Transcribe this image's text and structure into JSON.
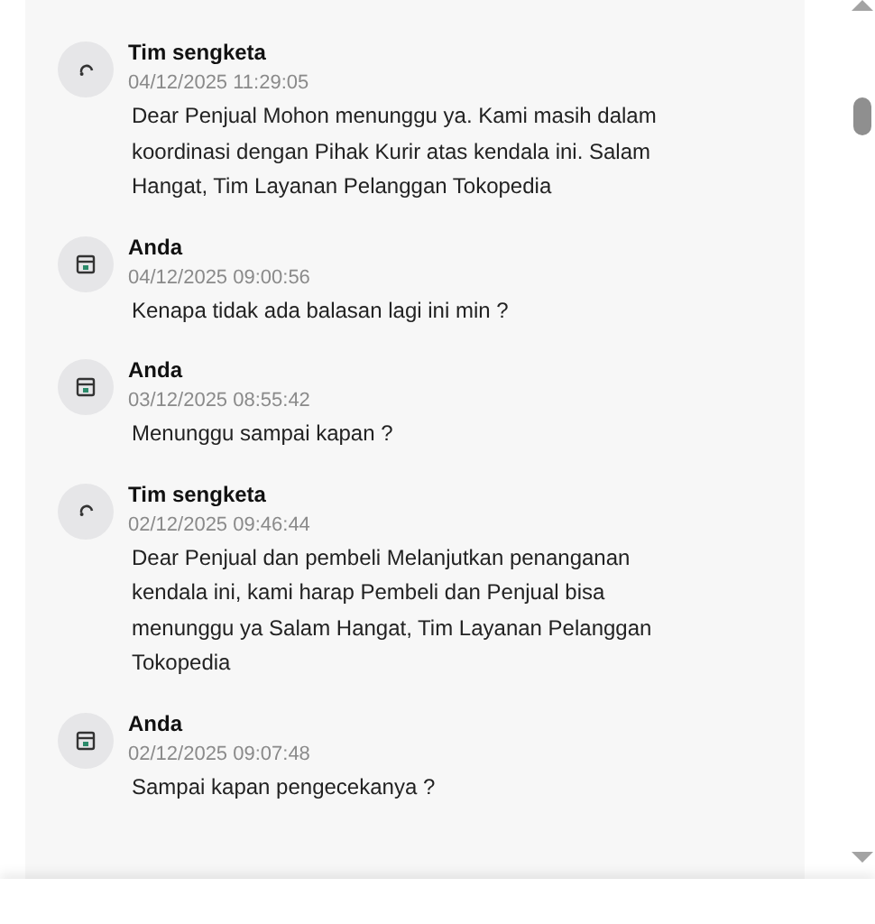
{
  "messages": [
    {
      "kind": "agent",
      "sender": "Tim sengketa",
      "time": "04/12/2025 11:29:05",
      "text": "Dear Penjual Mohon menunggu ya. Kami masih dalam koordinasi dengan Pihak Kurir atas kendala ini. Salam Hangat, Tim Layanan Pelanggan Tokopedia"
    },
    {
      "kind": "user",
      "sender": "Anda",
      "time": "04/12/2025 09:00:56",
      "text": "Kenapa tidak ada balasan lagi ini min ?"
    },
    {
      "kind": "user",
      "sender": "Anda",
      "time": "03/12/2025 08:55:42",
      "text": "Menunggu sampai kapan ?"
    },
    {
      "kind": "agent",
      "sender": "Tim sengketa",
      "time": "02/12/2025 09:46:44",
      "text": "Dear Penjual dan pembeli Melanjutkan penanganan kendala ini, kami harap Pembeli dan Penjual bisa menunggu ya Salam Hangat, Tim Layanan Pelanggan Tokopedia"
    },
    {
      "kind": "user",
      "sender": "Anda",
      "time": "02/12/2025 09:07:48",
      "text": "Sampai kapan pengecekanya ?"
    }
  ]
}
